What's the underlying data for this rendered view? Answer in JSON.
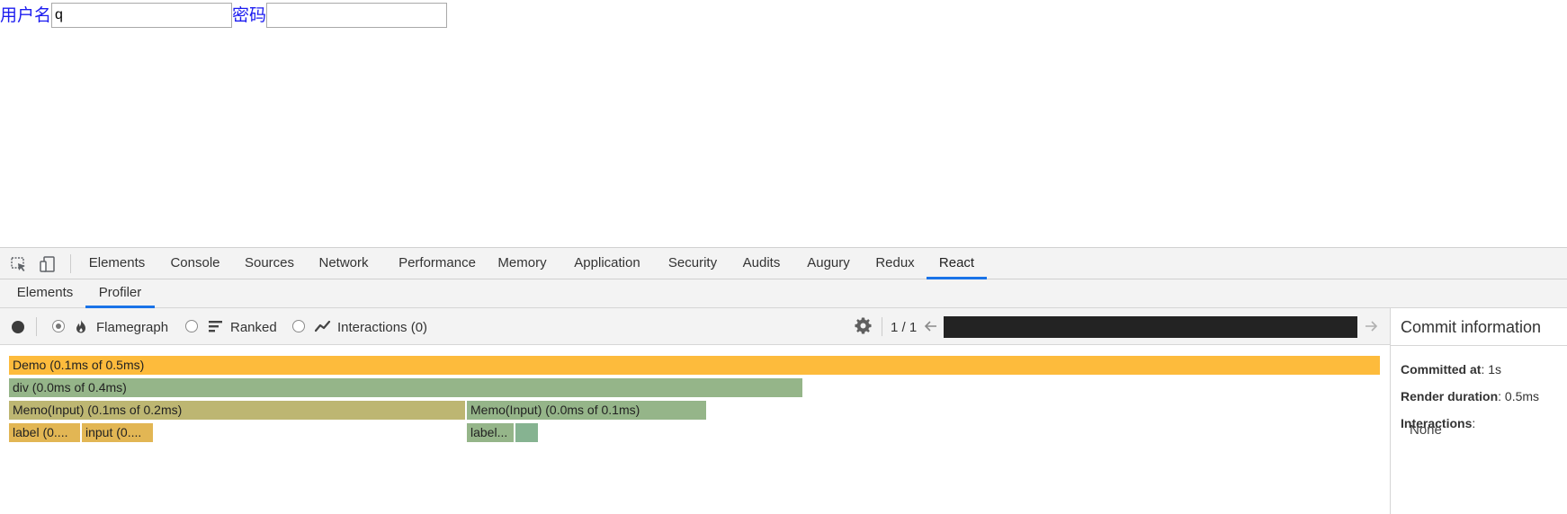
{
  "form": {
    "username_label": "用户名",
    "username_value": "q",
    "password_label": "密码",
    "password_value": ""
  },
  "devtools": {
    "main_tabs": [
      {
        "label": "Elements"
      },
      {
        "label": "Console"
      },
      {
        "label": "Sources"
      },
      {
        "label": "Network"
      },
      {
        "label": "Performance"
      },
      {
        "label": "Memory"
      },
      {
        "label": "Application"
      },
      {
        "label": "Security"
      },
      {
        "label": "Audits"
      },
      {
        "label": "Augury"
      },
      {
        "label": "Redux"
      },
      {
        "label": "React"
      }
    ],
    "active_main_tab": "React",
    "sub_tabs": [
      {
        "label": "Elements"
      },
      {
        "label": "Profiler"
      }
    ],
    "active_sub_tab": "Profiler",
    "toolbar": {
      "flamegraph_label": "Flamegraph",
      "ranked_label": "Ranked",
      "interactions_label": "Interactions (0)",
      "commit_counter": "1 / 1",
      "selected_view": "Flamegraph"
    },
    "flamegraph": [
      {
        "label": "Demo (0.1ms of 0.5ms)",
        "color": "#fdbb3c"
      },
      {
        "label": "div (0.0ms of 0.4ms)",
        "color": "#95b589"
      },
      {
        "label": "Memo(Input) (0.1ms of 0.2ms)",
        "color": "#bdb672"
      },
      {
        "label": "Memo(Input) (0.0ms of 0.1ms)",
        "color": "#95b589"
      },
      {
        "label": "label (0....",
        "color": "#e2b654"
      },
      {
        "label": "input (0....",
        "color": "#e2b654"
      },
      {
        "label": "label...",
        "color": "#95b589"
      },
      {
        "label": "",
        "color": "#86b391"
      }
    ],
    "commit_info": {
      "title": "Commit information",
      "committed_at_label": "Committed at",
      "committed_at_value": ": 1s",
      "render_duration_label": "Render duration",
      "render_duration_value": ": 0.5ms",
      "interactions_label": "Interactions",
      "interactions_suffix": ":",
      "interactions_value": "None"
    }
  },
  "colors": {
    "label_blue": "#1c1cf0",
    "active_tab_underline": "#1a73e8"
  },
  "icons": [
    "inspect-element-icon",
    "device-toggle-icon",
    "record-icon",
    "flame-icon",
    "ranked-icon",
    "interactions-icon",
    "gear-icon",
    "arrow-left-icon",
    "arrow-right-icon"
  ]
}
